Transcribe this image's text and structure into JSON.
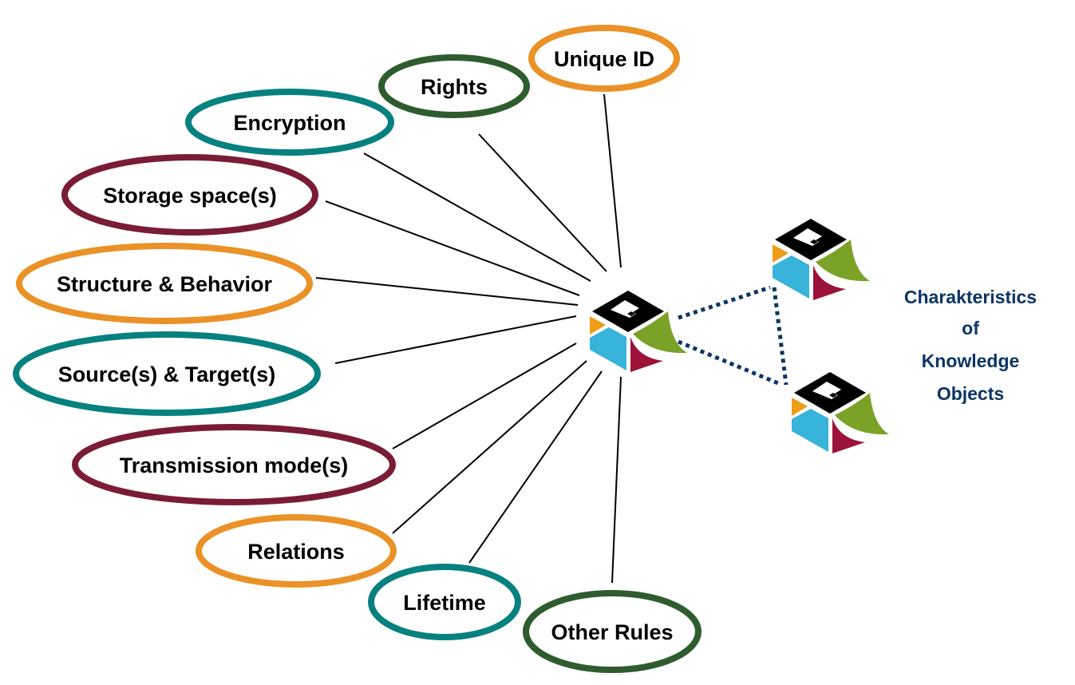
{
  "colors": {
    "orange": "#ea9227",
    "teal": "#06817f",
    "maroon": "#7a1c35",
    "green": "#2f5c2e",
    "connector": "#000000",
    "dotted_link": "#0b3564",
    "title": "#0b3564",
    "cube_black": "#000000",
    "cube_orange": "#ef9c16",
    "cube_blue": "#38b3d9",
    "cube_red": "#9b1338",
    "cube_green": "#7aa227"
  },
  "title": {
    "lines": [
      "Charakteristics",
      "of",
      "Knowledge",
      "Objects"
    ]
  },
  "nodes": [
    {
      "label": "Unique ID",
      "color": "orange"
    },
    {
      "label": "Rights",
      "color": "green"
    },
    {
      "label": "Encryption",
      "color": "teal"
    },
    {
      "label": "Storage space(s)",
      "color": "maroon"
    },
    {
      "label": "Structure & Behavior",
      "color": "orange"
    },
    {
      "label": "Source(s) & Target(s)",
      "color": "teal"
    },
    {
      "label": "Transmission mode(s)",
      "color": "maroon"
    },
    {
      "label": "Relations",
      "color": "orange"
    },
    {
      "label": "Lifetime",
      "color": "teal"
    },
    {
      "label": "Other Rules",
      "color": "green"
    }
  ],
  "cubes": [
    {
      "name": "central-knowledge-object"
    },
    {
      "name": "knowledge-object-top"
    },
    {
      "name": "knowledge-object-bottom"
    }
  ]
}
